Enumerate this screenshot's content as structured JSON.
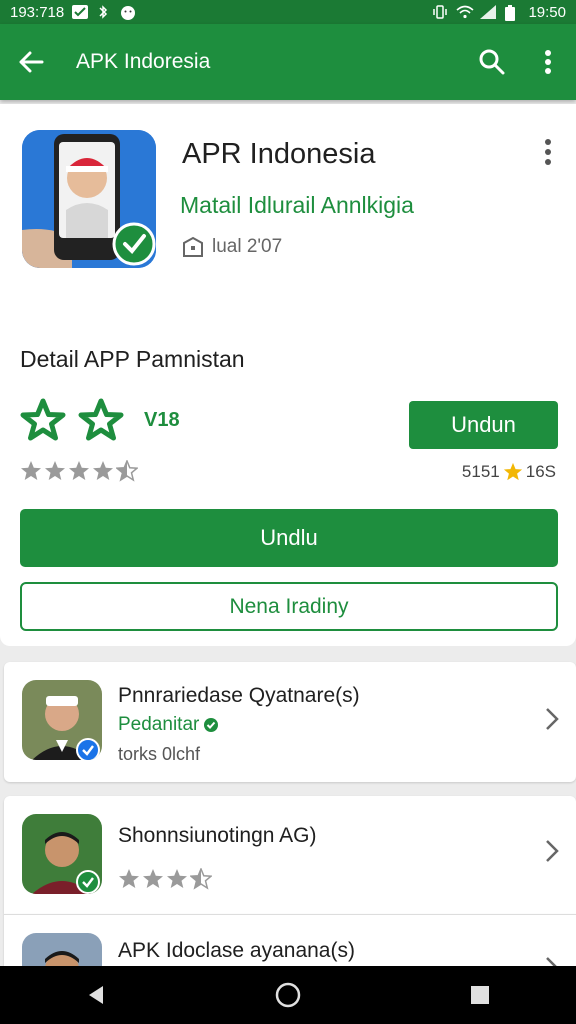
{
  "status_bar": {
    "time_left": "193:718",
    "time_right": "19:50"
  },
  "app_bar": {
    "title": "APK Indoresia",
    "back_icon": "arrow-left-icon",
    "search_icon": "search-icon",
    "menu_icon": "more-vert-icon"
  },
  "app": {
    "name": "APR Indonesia",
    "developer": "Matail Idlurail Annlkigia",
    "meta": "lual 2'07"
  },
  "details": {
    "section_title": "Detail APP Pamnistan",
    "rating_count": "V18",
    "right_meta_left": "5151",
    "right_meta_right": "16S",
    "small_button": "Undun",
    "big_button": "Undlu",
    "outline_button": "Nena Iradiny",
    "small_rating": 4.5
  },
  "list": [
    {
      "title": "Pnnrariedase Qyatnare(s)",
      "subtitle": "Pedanitar",
      "subtitle2": "torks 0lchf",
      "badge": "check"
    },
    {
      "title": "Shonnsiunotingn AG)",
      "rating": 3.5,
      "badge": "check"
    },
    {
      "title": "APK Idoclase ayanana(s)"
    }
  ],
  "colors": {
    "primary": "#1e8e3e",
    "status": "#1b7a34",
    "star": "#f2b705"
  }
}
